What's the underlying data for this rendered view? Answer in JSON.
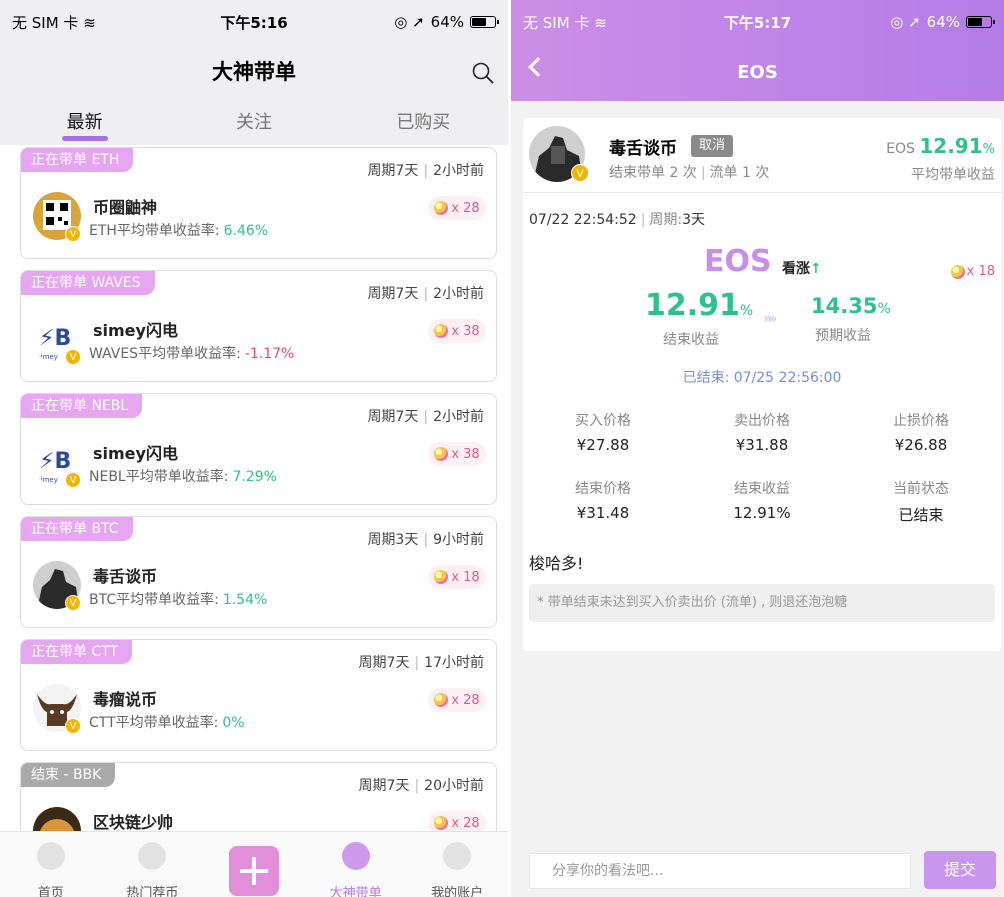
{
  "left": {
    "status": {
      "carrier": "无 SIM 卡",
      "time": "下午5:16",
      "battery": "64%",
      "battery_level": 0.64
    },
    "nav_title": "大神带单",
    "tabs": [
      {
        "label": "最新",
        "active": true
      },
      {
        "label": "关注",
        "active": false
      },
      {
        "label": "已购买",
        "active": false
      }
    ],
    "cards": [
      {
        "tag": "正在带单 ETH",
        "period": "周期7天",
        "ago": "2小时前",
        "name": "币圈鼬神",
        "rate_label": "ETH平均带单收益率:",
        "rate": "6.46%",
        "trend": "pos",
        "candy": "x 28",
        "avatar": "qr"
      },
      {
        "tag": "正在带单 WAVES",
        "period": "周期7天",
        "ago": "2小时前",
        "name": "simey闪电",
        "rate_label": "WAVES平均带单收益率:",
        "rate": "-1.17%",
        "trend": "neg",
        "candy": "x 38",
        "avatar": "simey"
      },
      {
        "tag": "正在带单 NEBL",
        "period": "周期7天",
        "ago": "2小时前",
        "name": "simey闪电",
        "rate_label": "NEBL平均带单收益率:",
        "rate": "7.29%",
        "trend": "pos",
        "candy": "x 38",
        "avatar": "simey"
      },
      {
        "tag": "正在带单 BTC",
        "period": "周期3天",
        "ago": "9小时前",
        "name": "毒舌谈币",
        "rate_label": "BTC平均带单收益率:",
        "rate": "1.54%",
        "trend": "pos",
        "candy": "x 18",
        "avatar": "dark"
      },
      {
        "tag": "正在带单 CTT",
        "period": "周期7天",
        "ago": "17小时前",
        "name": "毒瘤说币",
        "rate_label": "CTT平均带单收益率:",
        "rate": "0%",
        "trend": "pos",
        "candy": "x 28",
        "avatar": "bull"
      },
      {
        "tag": "结束 - BBK",
        "period": "周期7天",
        "ago": "20小时前",
        "name": "区块链少帅",
        "rate_label": "",
        "rate": "",
        "trend": "pos",
        "candy": "x 28",
        "avatar": "coin",
        "ended": true
      }
    ],
    "tabbar": [
      {
        "label": "首页"
      },
      {
        "label": "热门荐币"
      },
      {
        "label": ""
      },
      {
        "label": "大神带单",
        "active": true
      },
      {
        "label": "我的账户"
      }
    ]
  },
  "right": {
    "status": {
      "carrier": "无 SIM 卡",
      "time": "下午5:17",
      "battery": "64%",
      "battery_level": 0.64
    },
    "nav_title": "EOS",
    "author": {
      "name": "毒舌谈币",
      "cancel": "取消",
      "stats": [
        "结束带单 2 次",
        "流单 1 次"
      ],
      "coin": "EOS",
      "avg_rate": "12.91",
      "pct": "%",
      "avg_label": "平均带单收益"
    },
    "date": "07/22 22:54:52",
    "period_label": "周期:",
    "period_value": "3天",
    "coin": "EOS",
    "direction": "看涨",
    "candy": "x 18",
    "result_value": "12.91",
    "result_unit": "%",
    "result_label": "结束收益",
    "expected_value": "14.35",
    "expected_unit": "%",
    "expected_label": "预期收益",
    "ended_text": "已结束: 07/25 22:56:00",
    "grid": [
      {
        "k": "买入价格",
        "v": "¥27.88"
      },
      {
        "k": "卖出价格",
        "v": "¥31.88"
      },
      {
        "k": "止损价格",
        "v": "¥26.88"
      },
      {
        "k": "结束价格",
        "v": "¥31.48"
      },
      {
        "k": "结束收益",
        "v": "12.91%",
        "green": true
      },
      {
        "k": "当前状态",
        "v": "已结束"
      }
    ],
    "note": "梭哈多!",
    "tip": "* 带单结束未达到买入价卖出价 (流单) , 则退还泡泡糖",
    "comment_placeholder": "分享你的看法吧...",
    "submit": "提交"
  },
  "colors": {
    "accent": "#b77ae8",
    "tag": "#e6a6f2",
    "positive": "#2ec28a",
    "negative": "#f0446e"
  },
  "icons": [
    "search-icon",
    "back-icon",
    "home-icon",
    "hot-icon",
    "plus-icon",
    "thumb-icon",
    "account-icon",
    "candy-icon",
    "wifi-icon",
    "location-icon"
  ]
}
